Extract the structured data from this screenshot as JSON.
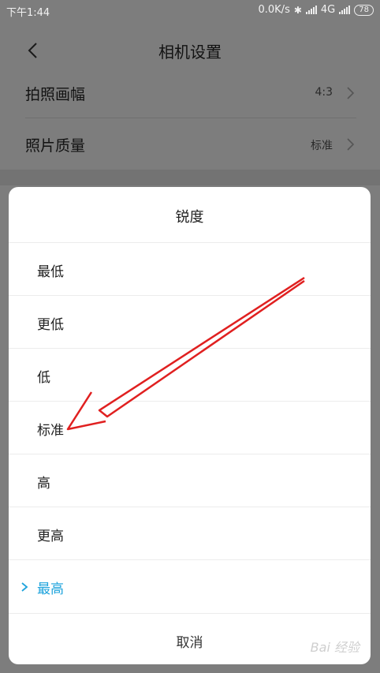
{
  "status": {
    "time": "下午1:44",
    "network_speed": "0.0K/s",
    "network_type": "4G",
    "battery": "78",
    "icons": [
      "bluetooth-icon",
      "signal-icon",
      "signal-icon",
      "battery-icon"
    ]
  },
  "header": {
    "back_icon": "chevron-left-icon",
    "title": "相机设置"
  },
  "settings": [
    {
      "label": "拍照画幅",
      "value": "4:3"
    },
    {
      "label": "照片质量",
      "value": "标准"
    }
  ],
  "sheet": {
    "title": "锐度",
    "options": [
      "最低",
      "更低",
      "低",
      "标准",
      "高",
      "更高",
      "最高"
    ],
    "selected": "最高",
    "cancel": "取消"
  },
  "colors": {
    "accent": "#1ea3dc",
    "annotation_arrow": "#e02020"
  },
  "watermark": "Bai 经验"
}
